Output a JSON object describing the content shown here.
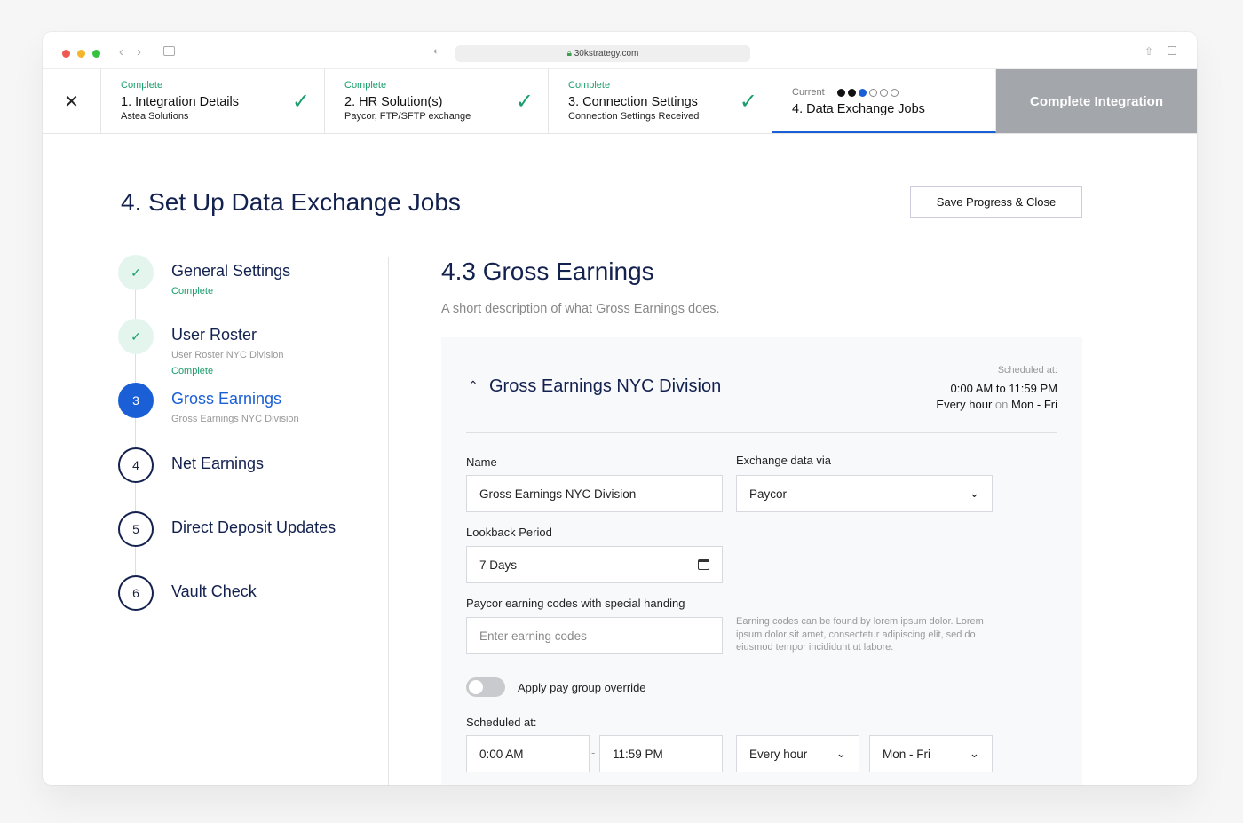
{
  "browser": {
    "url": "30kstrategy.com"
  },
  "steps": [
    {
      "status": "Complete",
      "title": "1. Integration Details",
      "subtitle": "Astea Solutions"
    },
    {
      "status": "Complete",
      "title": "2. HR Solution(s)",
      "subtitle": "Paycor, FTP/SFTP exchange"
    },
    {
      "status": "Complete",
      "title": "3. Connection Settings",
      "subtitle": "Connection Settings Received"
    },
    {
      "status": "Current",
      "title": "4. Data Exchange Jobs",
      "progress_done": 2,
      "progress_current": 3,
      "progress_total": 6
    }
  ],
  "complete_integration": "Complete Integration",
  "page_title": "4. Set Up Data Exchange Jobs",
  "save_label": "Save Progress & Close",
  "nav": [
    {
      "num": "✓",
      "label": "General Settings",
      "status": "Complete"
    },
    {
      "num": "✓",
      "label": "User Roster",
      "sub": "User Roster NYC Division",
      "status": "Complete"
    },
    {
      "num": "3",
      "label": "Gross Earnings",
      "sub": "Gross Earnings NYC Division"
    },
    {
      "num": "4",
      "label": "Net Earnings"
    },
    {
      "num": "5",
      "label": "Direct Deposit Updates"
    },
    {
      "num": "6",
      "label": "Vault Check"
    }
  ],
  "section": {
    "title": "4.3 Gross Earnings",
    "description": "A short description of what Gross Earnings does."
  },
  "card": {
    "title": "Gross Earnings NYC Division",
    "scheduled_label": "Scheduled at:",
    "time_range": "0:00 AM to 11:59 PM",
    "freq": "Every hour",
    "on": "on",
    "days": "Mon - Fri",
    "name_label": "Name",
    "name_value": "Gross Earnings NYC Division",
    "via_label": "Exchange data via",
    "via_value": "Paycor",
    "lookback_label": "Lookback Period",
    "lookback_value": "7 Days",
    "codes_label": "Paycor earning codes with special handing",
    "codes_placeholder": "Enter earning codes",
    "codes_help": "Earning codes can be found by lorem ipsum dolor. Lorem ipsum dolor sit amet, consectetur adipiscing elit, sed do eiusmod tempor incididunt ut labore.",
    "override_label": "Apply pay group override",
    "override_on": false,
    "sched_label": "Scheduled at:",
    "start": "0:00 AM",
    "dash": "-",
    "end": "11:59 PM",
    "freq_select": "Every hour",
    "days_select": "Mon - Fri"
  }
}
